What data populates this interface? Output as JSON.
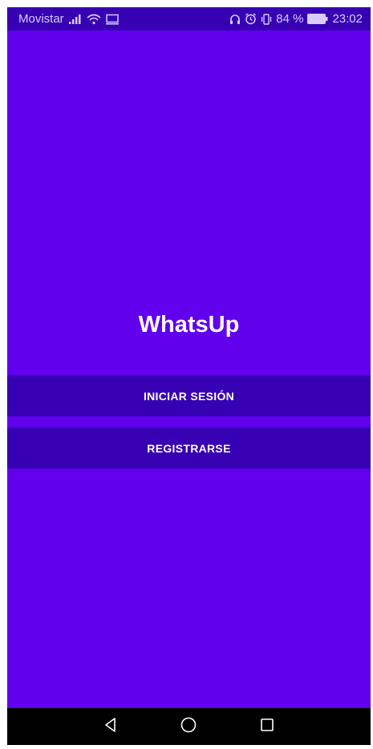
{
  "status_bar": {
    "carrier": "Movistar",
    "battery_percent": "84 %",
    "time": "23:02",
    "icons": [
      "signal-icon",
      "wifi-icon",
      "cast-icon",
      "headphones-icon",
      "alarm-icon",
      "vibrate-icon",
      "battery-icon"
    ]
  },
  "app": {
    "title": "WhatsUp",
    "login_label": "INICIAR SESIÓN",
    "register_label": "REGISTRARSE"
  },
  "nav_bar": {
    "icons": [
      "back-icon",
      "home-icon",
      "recents-icon"
    ]
  },
  "colors": {
    "background": "#6200ee",
    "primary_dark": "#3700b3",
    "text": "#ffffff"
  }
}
